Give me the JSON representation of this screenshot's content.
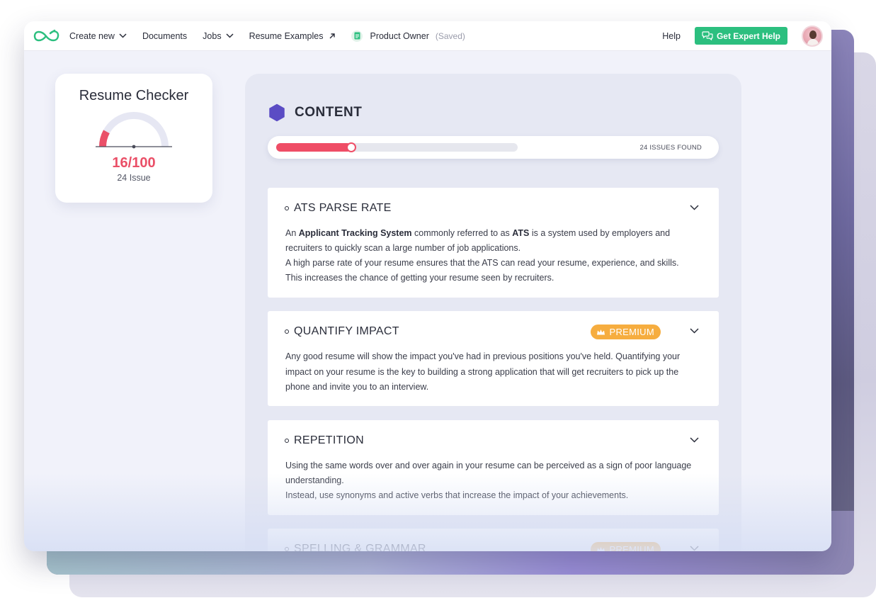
{
  "nav": {
    "create_new": "Create new",
    "documents": "Documents",
    "jobs": "Jobs",
    "resume_examples": "Resume Examples",
    "document_name": "Product Owner",
    "saved_status": "(Saved)",
    "help": "Help",
    "expert_help": "Get Expert Help"
  },
  "checker": {
    "title": "Resume Checker",
    "score_text": "16/100",
    "score": 16,
    "max_score": 100,
    "issues_label": "24 Issue"
  },
  "content": {
    "title": "CONTENT",
    "progress_fraction": 0.31,
    "issues_found": "24 ISSUES FOUND",
    "sections": [
      {
        "title": "ATS PARSE RATE",
        "p1_pre": "An ",
        "p1_bold1": "Applicant Tracking System",
        "p1_mid": " commonly referred to as ",
        "p1_bold2": "ATS",
        "p1_post": " is a system used by employers and recruiters to quickly scan a large number of job applications.",
        "p2": "A high parse rate of your resume ensures that the ATS can read your resume, experience, and skills. This increases the chance of getting your resume seen by recruiters."
      },
      {
        "title": "QUANTIFY IMPACT",
        "badge": "PREMIUM",
        "p1": "Any good resume will show the impact you've had in previous positions you've held. Quantifying your impact on your resume is the key to building a strong application that will get recruiters to pick up the phone and invite you to an interview."
      },
      {
        "title": "REPETITION",
        "p1": "Using the same words over and over again in your resume can be perceived as a sign of poor language understanding.",
        "p2": "Instead, use synonyms and active verbs that increase the impact of your achievements."
      },
      {
        "title": "SPELLING & GRAMMAR",
        "badge": "PREMIUM"
      }
    ]
  },
  "colors": {
    "accent_green": "#2cbf7f",
    "score_red": "#ea5068",
    "premium_orange": "#f6ad3f",
    "hex_purple": "#5b4cc4"
  }
}
